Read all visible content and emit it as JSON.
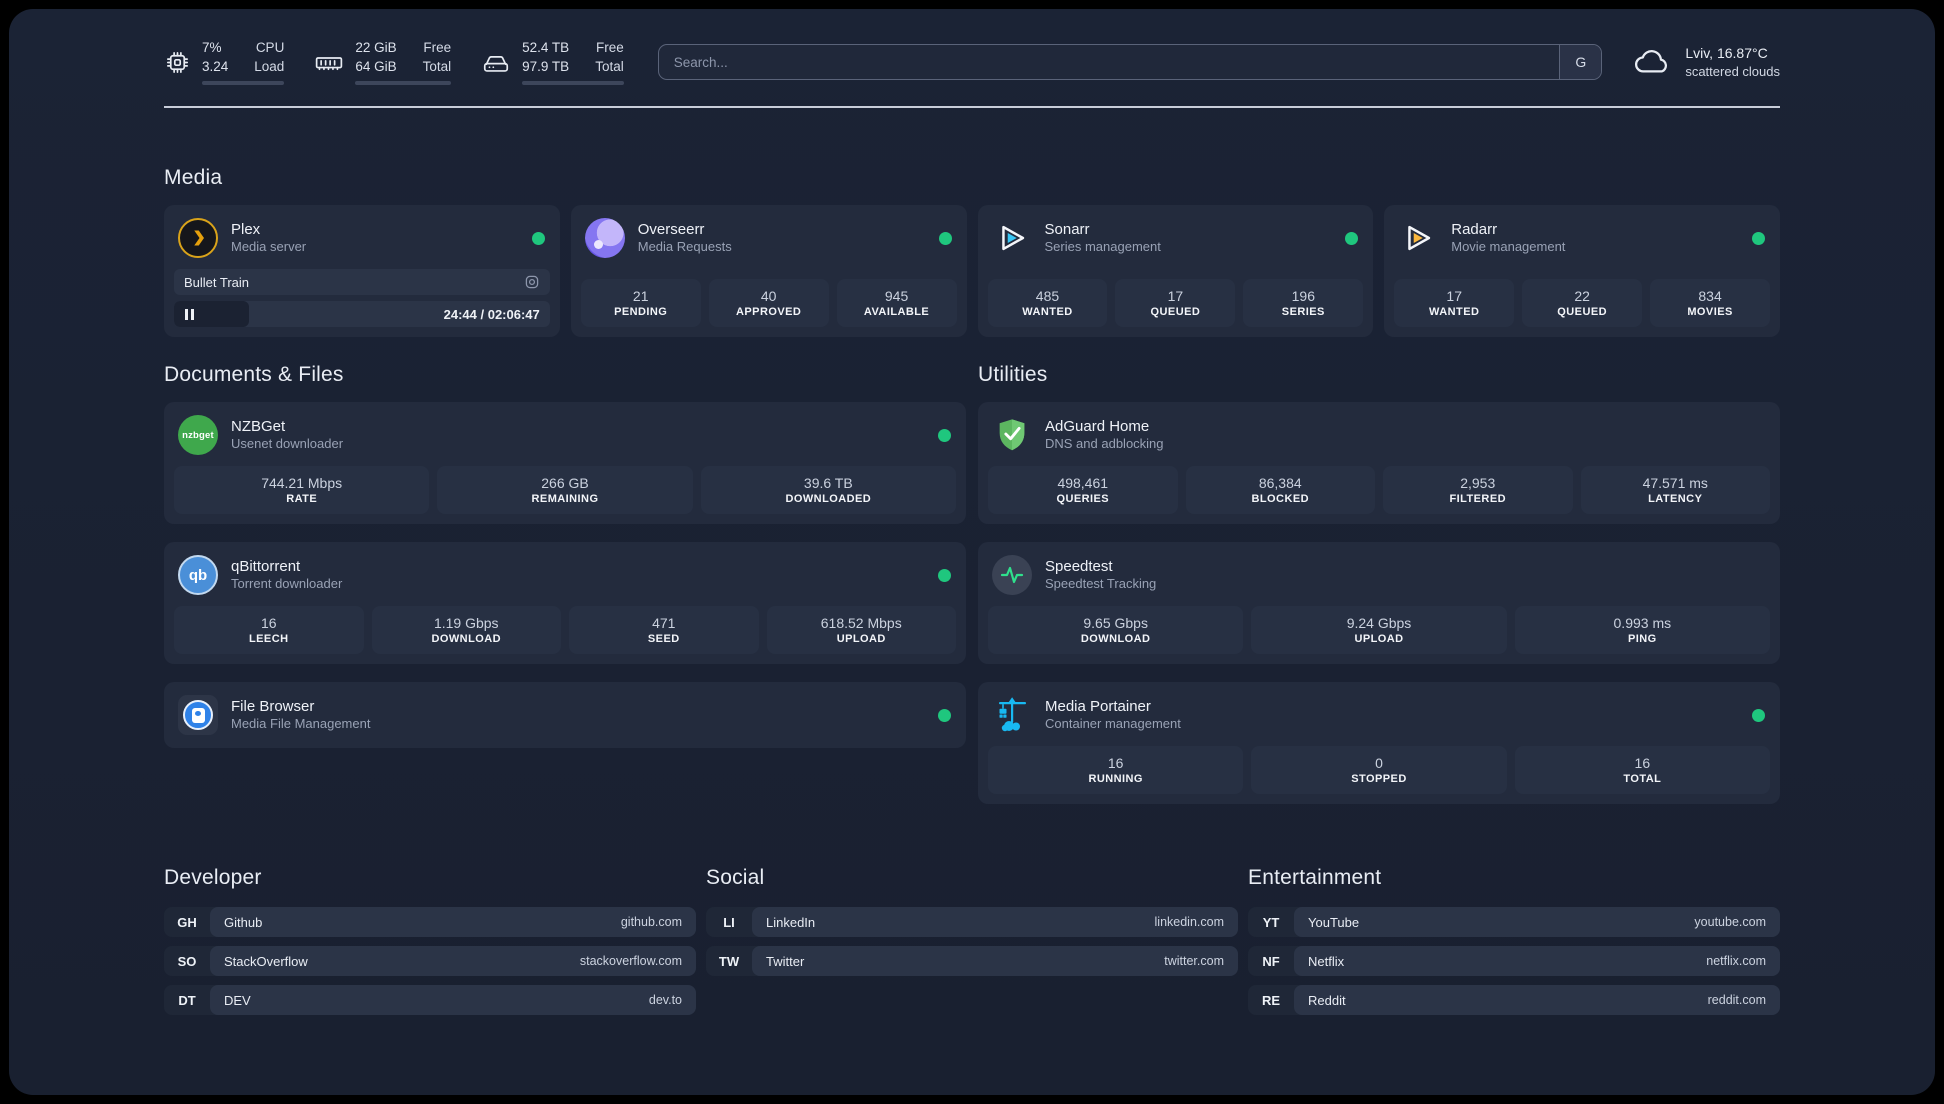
{
  "header": {
    "resources": [
      {
        "icon": "cpu-icon",
        "value_top": "7%",
        "value_bottom": "3.24",
        "label_top": "CPU",
        "label_bottom": "Load",
        "progress_pct": 8
      },
      {
        "icon": "memory-icon",
        "value_top": "22 GiB",
        "value_bottom": "64 GiB",
        "label_top": "Free",
        "label_bottom": "Total",
        "progress_pct": 65
      },
      {
        "icon": "disk-icon",
        "value_top": "52.4 TB",
        "value_bottom": "97.9 TB",
        "label_top": "Free",
        "label_bottom": "Total",
        "progress_pct": 46
      }
    ],
    "search": {
      "placeholder": "Search...",
      "provider_label": "G"
    },
    "weather": {
      "location": "Lviv, 16.87°C",
      "condition": "scattered clouds"
    }
  },
  "sections": {
    "media": {
      "title": "Media",
      "services": [
        {
          "name": "Plex",
          "description": "Media server",
          "icon": "plex-icon",
          "online": true,
          "now_playing": {
            "title": "Bullet Train",
            "time": "24:44 / 02:06:47",
            "progress_pct": 20
          }
        },
        {
          "name": "Overseerr",
          "description": "Media Requests",
          "icon": "overseerr-icon",
          "online": true,
          "stats": [
            {
              "value": "21",
              "label": "PENDING"
            },
            {
              "value": "40",
              "label": "APPROVED"
            },
            {
              "value": "945",
              "label": "AVAILABLE"
            }
          ]
        },
        {
          "name": "Sonarr",
          "description": "Series management",
          "icon": "sonarr-icon",
          "online": true,
          "stats": [
            {
              "value": "485",
              "label": "WANTED"
            },
            {
              "value": "17",
              "label": "QUEUED"
            },
            {
              "value": "196",
              "label": "SERIES"
            }
          ]
        },
        {
          "name": "Radarr",
          "description": "Movie management",
          "icon": "radarr-icon",
          "online": true,
          "stats": [
            {
              "value": "17",
              "label": "WANTED"
            },
            {
              "value": "22",
              "label": "QUEUED"
            },
            {
              "value": "834",
              "label": "MOVIES"
            }
          ]
        }
      ]
    },
    "documents": {
      "title": "Documents & Files",
      "services": [
        {
          "name": "NZBGet",
          "description": "Usenet downloader",
          "icon": "nzbget-icon",
          "online": true,
          "stats": [
            {
              "value": "744.21 Mbps",
              "label": "RATE"
            },
            {
              "value": "266 GB",
              "label": "REMAINING"
            },
            {
              "value": "39.6 TB",
              "label": "DOWNLOADED"
            }
          ]
        },
        {
          "name": "qBittorrent",
          "description": "Torrent downloader",
          "icon": "qbittorrent-icon",
          "online": true,
          "stats": [
            {
              "value": "16",
              "label": "LEECH"
            },
            {
              "value": "1.19 Gbps",
              "label": "DOWNLOAD"
            },
            {
              "value": "471",
              "label": "SEED"
            },
            {
              "value": "618.52 Mbps",
              "label": "UPLOAD"
            }
          ]
        },
        {
          "name": "File Browser",
          "description": "Media File Management",
          "icon": "filebrowser-icon",
          "online": true,
          "stats": []
        }
      ]
    },
    "utilities": {
      "title": "Utilities",
      "services": [
        {
          "name": "AdGuard Home",
          "description": "DNS and adblocking",
          "icon": "adguard-icon",
          "online": false,
          "stats": [
            {
              "value": "498,461",
              "label": "QUERIES"
            },
            {
              "value": "86,384",
              "label": "BLOCKED"
            },
            {
              "value": "2,953",
              "label": "FILTERED"
            },
            {
              "value": "47.571 ms",
              "label": "LATENCY"
            }
          ]
        },
        {
          "name": "Speedtest",
          "description": "Speedtest Tracking",
          "icon": "speedtest-icon",
          "online": false,
          "stats": [
            {
              "value": "9.65 Gbps",
              "label": "DOWNLOAD"
            },
            {
              "value": "9.24 Gbps",
              "label": "UPLOAD"
            },
            {
              "value": "0.993 ms",
              "label": "PING"
            }
          ]
        },
        {
          "name": "Media Portainer",
          "description": "Container management",
          "icon": "portainer-icon",
          "online": true,
          "stats": [
            {
              "value": "16",
              "label": "RUNNING"
            },
            {
              "value": "0",
              "label": "STOPPED"
            },
            {
              "value": "16",
              "label": "TOTAL"
            }
          ]
        }
      ]
    },
    "bookmarks": [
      {
        "title": "Developer",
        "links": [
          {
            "abbr": "GH",
            "name": "Github",
            "url": "github.com"
          },
          {
            "abbr": "SO",
            "name": "StackOverflow",
            "url": "stackoverflow.com"
          },
          {
            "abbr": "DT",
            "name": "DEV",
            "url": "dev.to"
          }
        ]
      },
      {
        "title": "Social",
        "links": [
          {
            "abbr": "LI",
            "name": "LinkedIn",
            "url": "linkedin.com"
          },
          {
            "abbr": "TW",
            "name": "Twitter",
            "url": "twitter.com"
          }
        ]
      },
      {
        "title": "Entertainment",
        "links": [
          {
            "abbr": "YT",
            "name": "YouTube",
            "url": "youtube.com"
          },
          {
            "abbr": "NF",
            "name": "Netflix",
            "url": "netflix.com"
          },
          {
            "abbr": "RE",
            "name": "Reddit",
            "url": "reddit.com"
          }
        ]
      }
    ]
  },
  "colors": {
    "status_online": "#1fc77e",
    "plex_accent": "#d9a31a",
    "background": "#1a2132",
    "card": "#232b3d"
  }
}
